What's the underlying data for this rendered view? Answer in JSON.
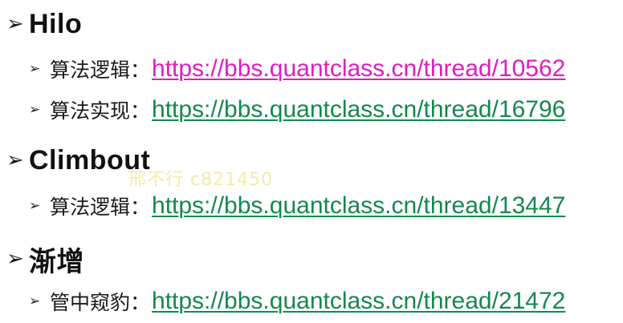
{
  "sections": [
    {
      "heading": "Hilo",
      "items": [
        {
          "label": "算法逻辑：",
          "url": "https://bbs.quantclass.cn/thread/10562",
          "color": "#e01bc5"
        },
        {
          "label": "算法实现：",
          "url": "https://bbs.quantclass.cn/thread/16796",
          "color": "#13894b"
        }
      ]
    },
    {
      "heading": "Climbout",
      "items": [
        {
          "label": "算法逻辑：",
          "url": "https://bbs.quantclass.cn/thread/13447",
          "color": "#13894b"
        }
      ]
    },
    {
      "heading": "渐增",
      "items": [
        {
          "label": "管中窥豹：",
          "url": "https://bbs.quantclass.cn/thread/21472",
          "color": "#13894b"
        }
      ]
    }
  ],
  "watermark": "邢不行 c821450",
  "bullet_icons": {
    "section": "arrowhead-bullet-icon",
    "item": "small-arrowhead-bullet-icon"
  }
}
